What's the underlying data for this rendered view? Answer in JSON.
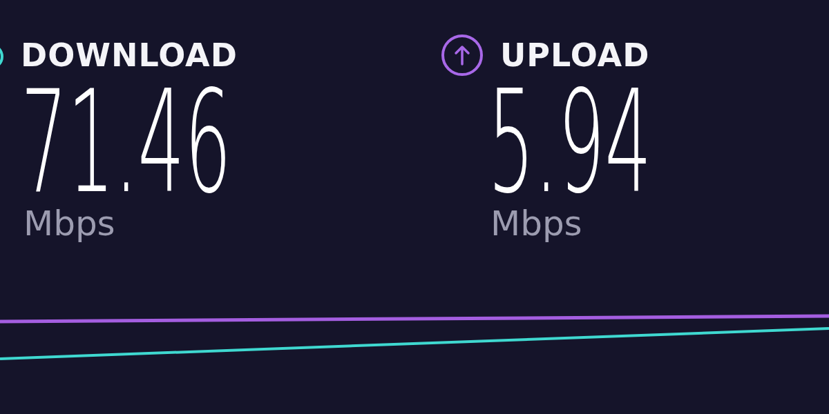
{
  "results": [
    {
      "kind": "download",
      "color": "#3fd8d0",
      "label": "DOWNLOAD",
      "value": "71.46",
      "unit": "Mbps"
    },
    {
      "kind": "upload",
      "color": "#a868e8",
      "label": "UPLOAD",
      "value": "5.94",
      "unit": "Mbps"
    }
  ]
}
